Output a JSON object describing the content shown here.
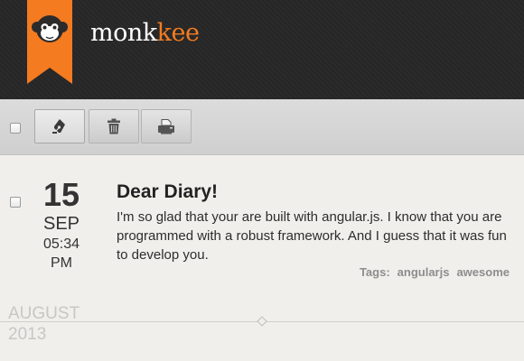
{
  "app": {
    "name_part1": "monk",
    "name_part2": "kee",
    "brand_color": "#f47b20",
    "logo_icon": "monkey-icon"
  },
  "toolbar": {
    "buttons": [
      {
        "name": "new-entry",
        "icon": "fountain-pen-icon"
      },
      {
        "name": "delete",
        "icon": "trash-icon"
      },
      {
        "name": "print",
        "icon": "printer-icon"
      }
    ]
  },
  "entry": {
    "day": "15",
    "month": "SEP",
    "time": "05:34",
    "ampm": "PM",
    "title": "Dear Diary!",
    "body": "I'm so glad that your are built with angular.js. I know that you are programmed with a robust framework. And I guess that it was fun to develop you.",
    "tags_label": "Tags:",
    "tags": [
      "angularjs",
      "awesome"
    ]
  },
  "divider": {
    "month": "AUGUST",
    "year": "2013"
  }
}
